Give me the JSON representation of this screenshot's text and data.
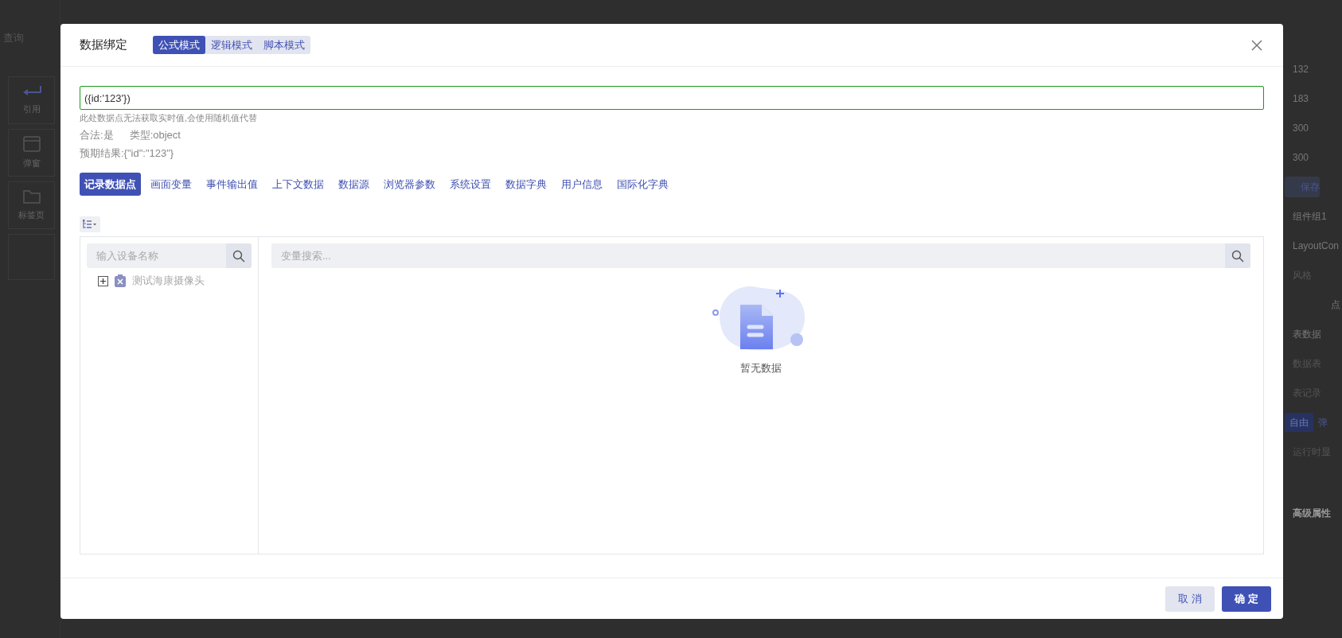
{
  "background": {
    "search_label": "查询",
    "left_items": [
      {
        "label": "引用",
        "kind": "enter"
      },
      {
        "label": "弹窗",
        "kind": "window"
      },
      {
        "label": "标签页",
        "kind": "folder"
      }
    ],
    "right_items": [
      {
        "kind": "text",
        "label": "132"
      },
      {
        "kind": "text",
        "label": "183"
      },
      {
        "kind": "text",
        "label": "300"
      },
      {
        "kind": "text",
        "label": "300"
      },
      {
        "kind": "button",
        "label": "保存"
      },
      {
        "kind": "text",
        "label": "组件组1"
      },
      {
        "kind": "text",
        "label": "LayoutCon"
      },
      {
        "kind": "muted",
        "label": "风格"
      },
      {
        "kind": "end",
        "label": "点"
      },
      {
        "kind": "text",
        "label": "表数据"
      },
      {
        "kind": "muted",
        "label": "数据表"
      },
      {
        "kind": "muted",
        "label": "表记录"
      },
      {
        "kind": "toggle",
        "options": [
          {
            "label": "自由",
            "selected": true
          },
          {
            "label": "弹",
            "selected": false
          }
        ]
      },
      {
        "kind": "muted",
        "label": "运行时显"
      },
      {
        "kind": "heading",
        "label": "高级属性"
      }
    ]
  },
  "dialog": {
    "title": "数据绑定",
    "modes": [
      {
        "label": "公式模式",
        "selected": true
      },
      {
        "label": "逻辑模式",
        "selected": false
      },
      {
        "label": "脚本模式",
        "selected": false
      }
    ],
    "expression": "({id:'123'})",
    "hint": "此处数据点无法获取实时值,会使用随机值代替",
    "valid": "合法:是",
    "type": "类型:object",
    "expected": "预期结果:{\"id\":\"123\"}",
    "source_tabs": [
      {
        "label": "记录数据点",
        "selected": true
      },
      {
        "label": "画面变量",
        "selected": false
      },
      {
        "label": "事件输出值",
        "selected": false
      },
      {
        "label": "上下文数据",
        "selected": false
      },
      {
        "label": "数据源",
        "selected": false
      },
      {
        "label": "浏览器参数",
        "selected": false
      },
      {
        "label": "系统设置",
        "selected": false
      },
      {
        "label": "数据字典",
        "selected": false
      },
      {
        "label": "用户信息",
        "selected": false
      },
      {
        "label": "国际化字典",
        "selected": false
      }
    ],
    "device_search": {
      "placeholder": "输入设备名称"
    },
    "tree": [
      {
        "label": "测试海康摄像头",
        "expanded": false
      }
    ],
    "variable_search": {
      "placeholder": "变量搜索..."
    },
    "empty_text": "暂无数据",
    "buttons": [
      {
        "label": "取 消",
        "kind": "secondary"
      },
      {
        "label": "确 定",
        "kind": "primary"
      }
    ]
  }
}
